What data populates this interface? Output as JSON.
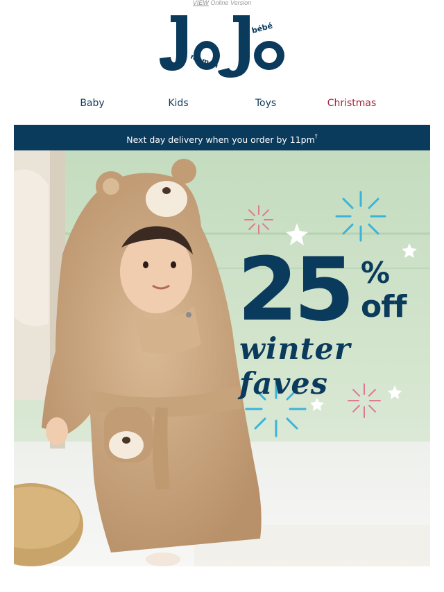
{
  "preheader": {
    "view_link": "VIEW",
    "view_rest": "Online Version"
  },
  "logo": {
    "main": "JoJo",
    "top_word": "bébé",
    "side_word": "maman"
  },
  "nav": {
    "items": [
      {
        "label": "Baby"
      },
      {
        "label": "Kids"
      },
      {
        "label": "Toys"
      },
      {
        "label": "Christmas"
      }
    ]
  },
  "banner": {
    "text": "Next day delivery when you order by 11pm",
    "mark": "†"
  },
  "hero": {
    "discount_number": "25",
    "discount_symbol": "%",
    "discount_suffix": "off",
    "subtitle": "winter faves"
  },
  "colors": {
    "navy": "#0a3a5c",
    "christmas_red": "#a3263f",
    "hero_bg": "#c7dfc2",
    "robe": "#c9a57f",
    "firework_blue": "#3ab3d8",
    "firework_pink": "#e07a90"
  }
}
